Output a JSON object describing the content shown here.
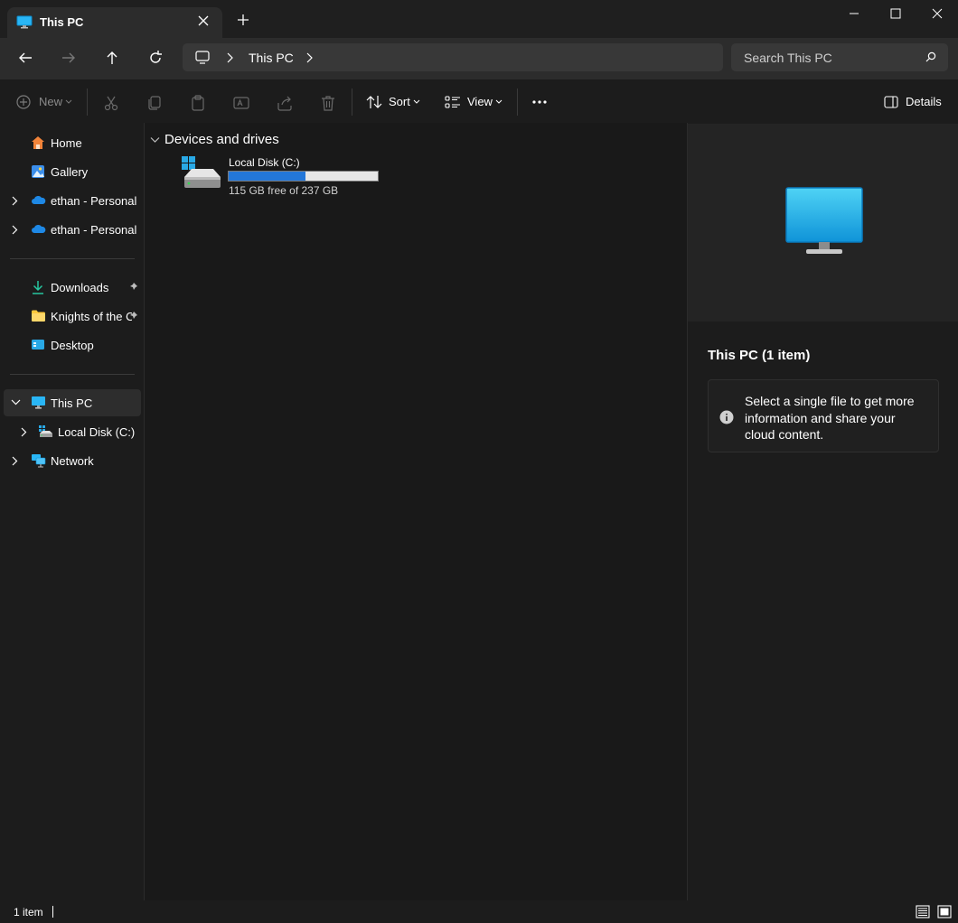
{
  "window": {
    "tab_title": "This PC",
    "new_tab_symbol": "+"
  },
  "address_bar": {
    "crumb": "This PC",
    "search_placeholder": "Search This PC"
  },
  "command_bar": {
    "new_label": "New",
    "sort_label": "Sort",
    "view_label": "View",
    "details_label": "Details"
  },
  "sidebar": {
    "home": "Home",
    "gallery": "Gallery",
    "onedrive_1": "ethan - Personal",
    "onedrive_2": "ethan - Personal",
    "downloads": "Downloads",
    "knights": "Knights of the O",
    "desktop": "Desktop",
    "this_pc": "This PC",
    "local_disk": "Local Disk (C:)",
    "network": "Network"
  },
  "content": {
    "group_title": "Devices and drives",
    "drive": {
      "name": "Local Disk (C:)",
      "free_text": "115 GB free of 237 GB",
      "used_fraction": 0.515
    }
  },
  "details": {
    "title": "This PC (1 item)",
    "info_text": "Select a single file to get more information and share your cloud content."
  },
  "status": {
    "item_count": "1 item"
  },
  "colors": {
    "accent": "#2377d9",
    "background": "#191919",
    "selection": "#2d2d2d"
  }
}
